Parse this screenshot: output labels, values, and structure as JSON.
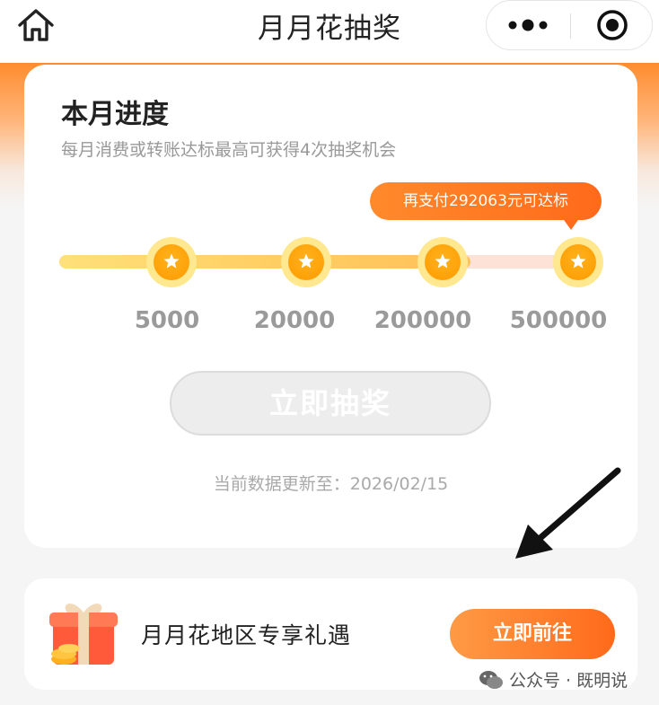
{
  "header": {
    "title": "月月花抽奖",
    "home_icon": "home-icon",
    "menu_icon": "more-dots-icon",
    "close_icon": "target-icon"
  },
  "progress_card": {
    "title": "本月进度",
    "subtitle": "每月消费或转账达标最高可获得4次抽奖机会",
    "tip": "再支付292063元可达标",
    "milestones": [
      {
        "label": "5000",
        "reached": true
      },
      {
        "label": "20000",
        "reached": true
      },
      {
        "label": "200000",
        "reached": true
      },
      {
        "label": "500000",
        "reached": false
      }
    ],
    "progress_fraction": 0.79,
    "draw_button": "立即抽奖",
    "update_text": "当前数据更新至：2026/02/15"
  },
  "offer_card": {
    "icon": "gift-box-icon",
    "text": "月月花地区专享礼遇",
    "button": "立即前往"
  },
  "watermark": {
    "icon": "wechat-icon",
    "text": "公众号 · 既明说"
  },
  "colors": {
    "accent": "#ff6a1a",
    "star": "#ff9a00",
    "track_fill": "#ffcf63",
    "track_empty": "#fde3d7"
  }
}
